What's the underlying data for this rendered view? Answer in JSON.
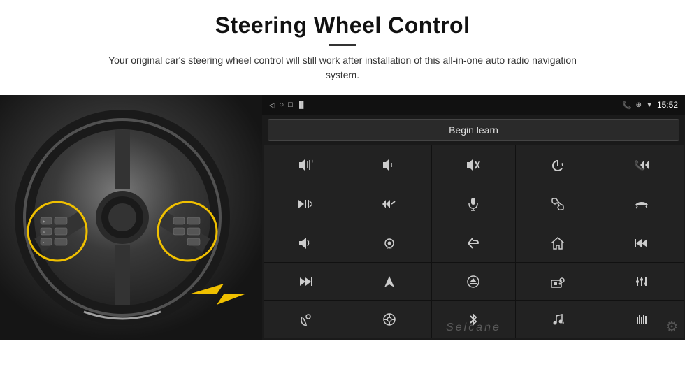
{
  "header": {
    "title": "Steering Wheel Control",
    "subtitle": "Your original car's steering wheel control will still work after installation of this all-in-one auto radio navigation system."
  },
  "android": {
    "statusbar": {
      "time": "15:52",
      "icons_left": [
        "◁",
        "○",
        "□",
        "⚡"
      ],
      "icons_right": [
        "📞",
        "⊕",
        "▼"
      ]
    },
    "begin_learn_label": "Begin learn",
    "seicane_label": "Seicane",
    "buttons": [
      {
        "icon": "🔊+",
        "label": "vol-up"
      },
      {
        "icon": "🔊−",
        "label": "vol-down"
      },
      {
        "icon": "🔇",
        "label": "mute"
      },
      {
        "icon": "⏻",
        "label": "power"
      },
      {
        "icon": "⏮",
        "label": "prev-phone"
      },
      {
        "icon": "⏭",
        "label": "next"
      },
      {
        "icon": "⏩",
        "label": "fast-forward"
      },
      {
        "icon": "🎙",
        "label": "mic"
      },
      {
        "icon": "📞",
        "label": "call"
      },
      {
        "icon": "📵",
        "label": "end-call"
      },
      {
        "icon": "📢",
        "label": "horn"
      },
      {
        "icon": "360°",
        "label": "camera"
      },
      {
        "icon": "↩",
        "label": "back"
      },
      {
        "icon": "⌂",
        "label": "home"
      },
      {
        "icon": "⏮⏮",
        "label": "prev-track"
      },
      {
        "icon": "⏭⏭",
        "label": "skip"
      },
      {
        "icon": "▶",
        "label": "play"
      },
      {
        "icon": "⊙",
        "label": "eject"
      },
      {
        "icon": "📻",
        "label": "radio"
      },
      {
        "icon": "⚙",
        "label": "eq"
      },
      {
        "icon": "🎤",
        "label": "mic2"
      },
      {
        "icon": "🎛",
        "label": "control"
      },
      {
        "icon": "✱",
        "label": "bt"
      },
      {
        "icon": "🎵",
        "label": "music"
      },
      {
        "icon": "📊",
        "label": "eq2"
      }
    ]
  },
  "icons": {
    "gear": "⚙",
    "settings": "⚙"
  }
}
